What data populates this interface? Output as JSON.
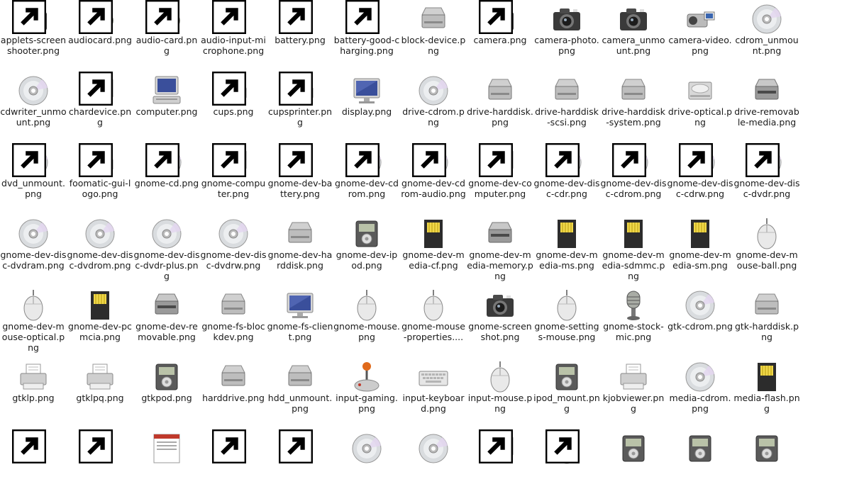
{
  "rows": [
    [
      {
        "label": "applets-screenshooter.png",
        "icon": "camera-icon"
      },
      {
        "label": "audiocard.png",
        "icon": "speaker-icon"
      },
      {
        "label": "audio-card.png",
        "icon": "speaker-icon"
      },
      {
        "label": "audio-input-microphone.png",
        "icon": "microphone-icon"
      },
      {
        "label": "battery.png",
        "icon": "battery-icon"
      },
      {
        "label": "battery-good-charging.png",
        "icon": "battery-icon"
      },
      {
        "label": "block-device.png",
        "icon": "harddisk-icon"
      },
      {
        "label": "camera.png",
        "icon": "camera-icon"
      },
      {
        "label": "camera-photo.png",
        "icon": "camera-icon"
      },
      {
        "label": "camera_unmount.png",
        "icon": "camera-icon"
      },
      {
        "label": "camera-video.png",
        "icon": "video-camera-icon"
      },
      {
        "label": "cdrom_unmount.png",
        "icon": "disc-icon"
      }
    ],
    [
      {
        "label": "cdwriter_unmount.png",
        "icon": "disc-icon"
      },
      {
        "label": "chardevice.png",
        "icon": "monitor-icon"
      },
      {
        "label": "computer.png",
        "icon": "computer-icon"
      },
      {
        "label": "cups.png",
        "icon": "printer-icon"
      },
      {
        "label": "cupsprinter.png",
        "icon": "printer-icon"
      },
      {
        "label": "display.png",
        "icon": "monitor-icon"
      },
      {
        "label": "drive-cdrom.png",
        "icon": "disc-icon"
      },
      {
        "label": "drive-harddisk.png",
        "icon": "harddisk-icon"
      },
      {
        "label": "drive-harddisk-scsi.png",
        "icon": "harddisk-icon"
      },
      {
        "label": "drive-harddisk-system.png",
        "icon": "harddisk-icon"
      },
      {
        "label": "drive-optical.png",
        "icon": "optical-drive-icon"
      },
      {
        "label": "drive-removable-media.png",
        "icon": "removable-drive-icon"
      }
    ],
    [
      {
        "label": "dvd_unmount.png",
        "icon": "disc-icon"
      },
      {
        "label": "foomatic-gui-logo.png",
        "icon": "printer-icon"
      },
      {
        "label": "gnome-cd.png",
        "icon": "disc-icon"
      },
      {
        "label": "gnome-computer.png",
        "icon": "monitor-icon"
      },
      {
        "label": "gnome-dev-battery.png",
        "icon": "battery-icon"
      },
      {
        "label": "gnome-dev-cdrom.png",
        "icon": "disc-icon"
      },
      {
        "label": "gnome-dev-cdrom-audio.png",
        "icon": "disc-icon"
      },
      {
        "label": "gnome-dev-computer.png",
        "icon": "monitor-icon"
      },
      {
        "label": "gnome-dev-disc-cdr.png",
        "icon": "disc-icon"
      },
      {
        "label": "gnome-dev-disc-cdrom.png",
        "icon": "disc-icon"
      },
      {
        "label": "gnome-dev-disc-cdrw.png",
        "icon": "disc-icon"
      },
      {
        "label": "gnome-dev-disc-dvdr.png",
        "icon": "disc-icon"
      }
    ],
    [
      {
        "label": "gnome-dev-disc-dvdram.png",
        "icon": "disc-icon"
      },
      {
        "label": "gnome-dev-disc-dvdrom.png",
        "icon": "disc-icon"
      },
      {
        "label": "gnome-dev-disc-dvdr-plus.png",
        "icon": "disc-icon"
      },
      {
        "label": "gnome-dev-disc-dvdrw.png",
        "icon": "disc-icon"
      },
      {
        "label": "gnome-dev-harddisk.png",
        "icon": "harddisk-icon"
      },
      {
        "label": "gnome-dev-ipod.png",
        "icon": "ipod-icon"
      },
      {
        "label": "gnome-dev-media-cf.png",
        "icon": "memory-card-icon"
      },
      {
        "label": "gnome-dev-media-memory.png",
        "icon": "removable-drive-icon"
      },
      {
        "label": "gnome-dev-media-ms.png",
        "icon": "memory-card-icon"
      },
      {
        "label": "gnome-dev-media-sdmmc.png",
        "icon": "memory-card-icon"
      },
      {
        "label": "gnome-dev-media-sm.png",
        "icon": "memory-card-icon"
      },
      {
        "label": "gnome-dev-mouse-ball.png",
        "icon": "mouse-icon"
      }
    ],
    [
      {
        "label": "gnome-dev-mouse-optical.png",
        "icon": "mouse-icon"
      },
      {
        "label": "gnome-dev-pcmcia.png",
        "icon": "memory-card-icon"
      },
      {
        "label": "gnome-dev-removable.png",
        "icon": "removable-drive-icon"
      },
      {
        "label": "gnome-fs-blockdev.png",
        "icon": "harddisk-icon"
      },
      {
        "label": "gnome-fs-client.png",
        "icon": "monitor-icon"
      },
      {
        "label": "gnome-mouse.png",
        "icon": "mouse-icon"
      },
      {
        "label": "gnome-mouse-properties....",
        "icon": "mouse-icon"
      },
      {
        "label": "gnome-screenshot.png",
        "icon": "camera-icon"
      },
      {
        "label": "gnome-settings-mouse.png",
        "icon": "mouse-icon"
      },
      {
        "label": "gnome-stock-mic.png",
        "icon": "microphone-icon"
      },
      {
        "label": "gtk-cdrom.png",
        "icon": "disc-icon"
      },
      {
        "label": "gtk-harddisk.png",
        "icon": "harddisk-icon"
      }
    ],
    [
      {
        "label": "gtklp.png",
        "icon": "printer-icon"
      },
      {
        "label": "gtklpq.png",
        "icon": "printer-icon"
      },
      {
        "label": "gtkpod.png",
        "icon": "ipod-icon"
      },
      {
        "label": "harddrive.png",
        "icon": "harddisk-icon"
      },
      {
        "label": "hdd_unmount.png",
        "icon": "harddisk-icon"
      },
      {
        "label": "input-gaming.png",
        "icon": "joystick-icon"
      },
      {
        "label": "input-keyboard.png",
        "icon": "keyboard-icon"
      },
      {
        "label": "input-mouse.png",
        "icon": "mouse-icon"
      },
      {
        "label": "ipod_mount.png",
        "icon": "ipod-icon"
      },
      {
        "label": "kjobviewer.png",
        "icon": "printer-icon"
      },
      {
        "label": "media-cdrom.png",
        "icon": "disc-icon"
      },
      {
        "label": "media-flash.png",
        "icon": "memory-card-icon"
      }
    ],
    [
      {
        "label": "",
        "icon": "memory-card-icon"
      },
      {
        "label": "",
        "icon": "memory-card-icon"
      },
      {
        "label": "",
        "icon": "document-icon"
      },
      {
        "label": "",
        "icon": "memory-card-icon"
      },
      {
        "label": "",
        "icon": "memory-card-icon"
      },
      {
        "label": "",
        "icon": "disc-icon"
      },
      {
        "label": "",
        "icon": "disc-icon"
      },
      {
        "label": "",
        "icon": "monitor-icon"
      },
      {
        "label": "",
        "icon": "mouse-icon"
      },
      {
        "label": "",
        "icon": "ipod-icon"
      },
      {
        "label": "",
        "icon": "ipod-icon"
      },
      {
        "label": "",
        "icon": "ipod-icon"
      }
    ]
  ],
  "links": [
    [
      true,
      true,
      true,
      true,
      true,
      true,
      false,
      true,
      false,
      false,
      false,
      false
    ],
    [
      false,
      true,
      false,
      true,
      true,
      false,
      false,
      false,
      false,
      false,
      false,
      false
    ],
    [
      true,
      true,
      true,
      true,
      true,
      true,
      true,
      true,
      true,
      true,
      true,
      true
    ],
    [
      false,
      false,
      false,
      false,
      false,
      false,
      false,
      false,
      false,
      false,
      false,
      false
    ],
    [
      false,
      false,
      false,
      false,
      false,
      false,
      false,
      false,
      false,
      false,
      false,
      false
    ],
    [
      false,
      false,
      false,
      false,
      false,
      false,
      false,
      false,
      false,
      false,
      false,
      false
    ],
    [
      true,
      true,
      false,
      true,
      true,
      false,
      false,
      true,
      true,
      false,
      false,
      false
    ]
  ]
}
